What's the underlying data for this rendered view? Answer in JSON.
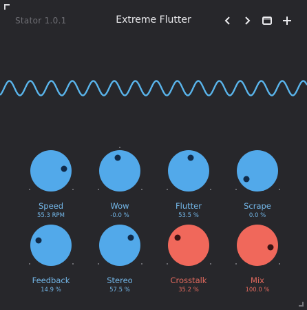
{
  "header": {
    "app_name": "Stator 1.0.1",
    "preset_name": "Extreme Flutter",
    "buttons": [
      "prev-preset",
      "next-preset",
      "preset-browser",
      "new-preset"
    ]
  },
  "colors": {
    "background": "#27272b",
    "blue_knob": "#52a9ea",
    "red_knob": "#f0685b",
    "blue_label": "#74b8ea",
    "red_label": "#e26a5e",
    "waveform": "#5ab5ec"
  },
  "knobs": [
    {
      "label": "Speed",
      "value": "55.3 RPM",
      "color": "blue",
      "level": 0.8
    },
    {
      "label": "Wow",
      "value": "-0.0 %",
      "color": "blue",
      "level": 0.47
    },
    {
      "label": "Flutter",
      "value": "53.5 %",
      "color": "blue",
      "level": 0.53
    },
    {
      "label": "Scrape",
      "value": "0.0 %",
      "color": "blue",
      "level": 0.03
    },
    {
      "label": "Feedback",
      "value": "14.9 %",
      "color": "blue",
      "level": 0.25
    },
    {
      "label": "Stereo",
      "value": "57.5 %",
      "color": "blue",
      "level": 0.71
    },
    {
      "label": "Crosstalk",
      "value": "35.2 %",
      "color": "red",
      "level": 0.3
    },
    {
      "label": "Mix",
      "value": "100.0 %",
      "color": "red",
      "level": 0.87
    }
  ]
}
